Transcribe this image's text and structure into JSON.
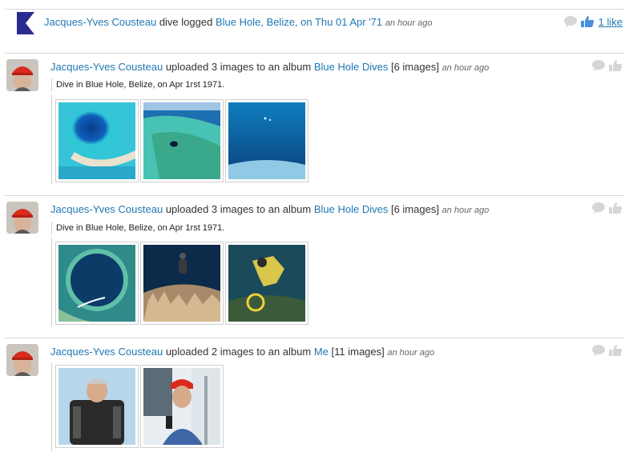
{
  "feed": [
    {
      "kind": "dive",
      "actor": "Jacques-Yves Cousteau",
      "verb": " dive logged ",
      "target": "Blue Hole, Belize, on Thu 01 Apr '71",
      "time": "an hour ago",
      "likes": "1 like"
    },
    {
      "kind": "album",
      "actor": "Jacques-Yves Cousteau",
      "verb": " uploaded 3 images to an album ",
      "album": "Blue Hole Dives",
      "count": " [6 images] ",
      "time": "an hour ago",
      "caption": "Dive in Blue Hole, Belize, on Apr 1rst 1971.",
      "images": [
        "blue-hole-aerial-1",
        "blue-hole-aerial-2",
        "underwater-blue-1"
      ]
    },
    {
      "kind": "album",
      "actor": "Jacques-Yves Cousteau",
      "verb": " uploaded 3 images to an album ",
      "album": "Blue Hole Dives",
      "count": " [6 images] ",
      "time": "an hour ago",
      "caption": "Dive in Blue Hole, Belize, on Apr 1rst 1971.",
      "images": [
        "blue-hole-aerial-3",
        "diver-coral",
        "diver-yellow-light"
      ]
    },
    {
      "kind": "album",
      "actor": "Jacques-Yves Cousteau",
      "verb": " uploaded 2 images to an album ",
      "album": "Me",
      "count": " [11 images] ",
      "time": "an hour ago",
      "images": [
        "cousteau-scuba",
        "cousteau-boat"
      ]
    }
  ],
  "colors": {
    "link": "#1f78b4",
    "logo": "#2a2b8f",
    "like_active": "#4a90d9",
    "icon_gray": "#d6d6d6"
  },
  "icons": {
    "comment": "comment-icon",
    "like": "thumbs-up-icon",
    "logo": "logbook-logo"
  }
}
